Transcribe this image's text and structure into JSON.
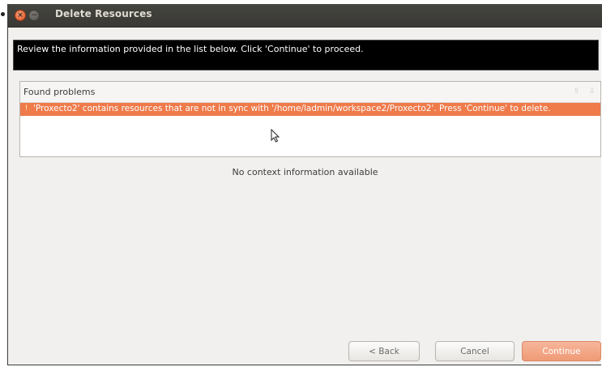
{
  "window": {
    "title": "Delete Resources",
    "close_glyph": "×",
    "min_glyph": "−"
  },
  "message": "Review the information provided in the list below. Click 'Continue' to proceed.",
  "problems": {
    "header": "Found problems",
    "up_arrow": "⇧",
    "down_arrow": "⇩",
    "items": [
      {
        "icon": "warning-icon",
        "glyph": "!",
        "text": "'Proxecto2' contains resources that are not in sync with '/home/ladmin/workspace2/Proxecto2'. Press 'Continue' to delete."
      }
    ]
  },
  "context_info": "No context information available",
  "buttons": {
    "back": "< Back",
    "cancel": "Cancel",
    "continue": "Continue"
  },
  "colors": {
    "accent": "#ef7a4a",
    "titlebar": "#3c3b37"
  }
}
